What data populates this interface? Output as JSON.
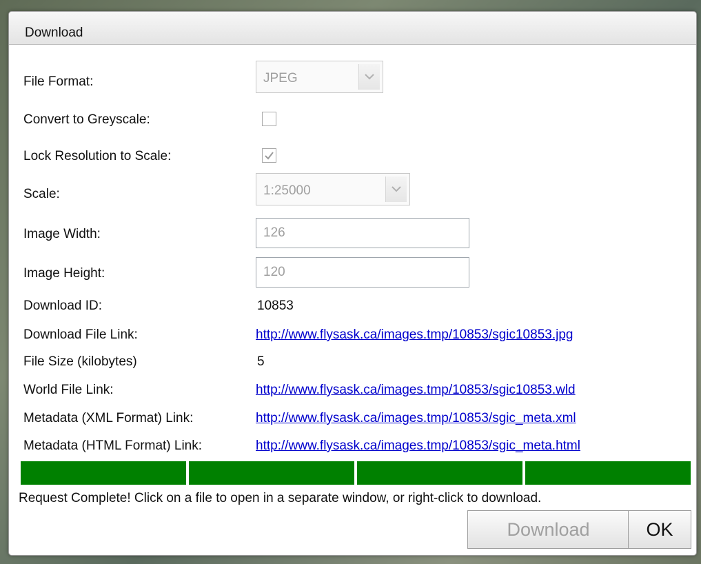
{
  "dialog": {
    "title": "Download",
    "fields": {
      "file_format_label": "File Format:",
      "file_format_value": "JPEG",
      "greyscale_label": "Convert to Greyscale:",
      "greyscale_checked": false,
      "lock_resolution_label": "Lock Resolution to Scale:",
      "lock_resolution_checked": true,
      "scale_label": "Scale:",
      "scale_value": "1:25000",
      "image_width_label": "Image Width:",
      "image_width_value": "126",
      "image_height_label": "Image Height:",
      "image_height_value": "120",
      "download_id_label": "Download ID:",
      "download_id_value": "10853",
      "download_file_link_label": "Download File Link:",
      "download_file_link": "http://www.flysask.ca/images.tmp/10853/sgic10853.jpg",
      "file_size_label": "File Size (kilobytes)",
      "file_size_value": "5",
      "world_file_link_label": "World File Link:",
      "world_file_link": "http://www.flysask.ca/images.tmp/10853/sgic10853.wld",
      "metadata_xml_label": "Metadata (XML Format) Link:",
      "metadata_xml_link": "http://www.flysask.ca/images.tmp/10853/sgic_meta.xml",
      "metadata_html_label": "Metadata (HTML Format) Link:",
      "metadata_html_link": "http://www.flysask.ca/images.tmp/10853/sgic_meta.html"
    },
    "progress": {
      "segments_total": 4,
      "segments_complete": 4,
      "color": "#008000"
    },
    "status_text": "Request Complete! Click on a file to open in a separate window, or right-click to download.",
    "buttons": {
      "download_label": "Download",
      "download_enabled": false,
      "ok_label": "OK"
    }
  }
}
